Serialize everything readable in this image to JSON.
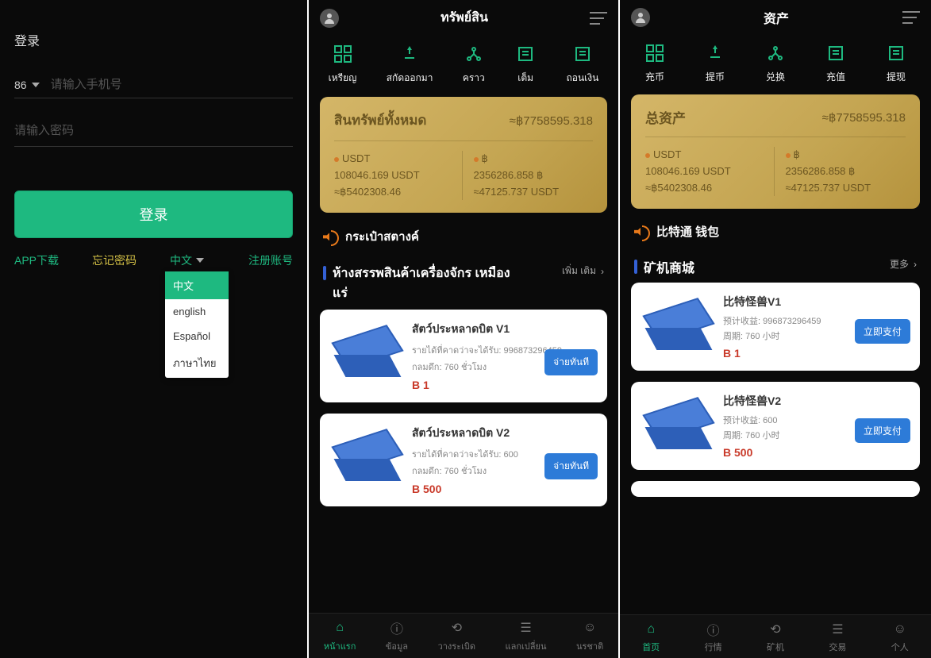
{
  "panel1": {
    "title": "登录",
    "country_code": "86",
    "phone_placeholder": "请输入手机号",
    "password_placeholder": "请输入密码",
    "login_btn": "登录",
    "app_download": "APP下载",
    "forgot_pwd": "忘记密码",
    "lang_current": "中文",
    "register": "注册账号",
    "lang_options": [
      "中文",
      "english",
      "Español",
      "ภาษาไทย"
    ]
  },
  "panel2": {
    "title": "ทรัพย์สิน",
    "actions": [
      {
        "label": "เหรียญ"
      },
      {
        "label": "สกัดออกมา"
      },
      {
        "label": "คราว"
      },
      {
        "label": "เต็ม"
      },
      {
        "label": "ถอนเงิน"
      }
    ],
    "asset": {
      "title": "สินทรัพย์ทั้งหมด",
      "total": "≈฿7758595.318",
      "col1_l1": "USDT",
      "col1_l2": "108046.169 USDT",
      "col1_l3": "≈฿5402308.46",
      "col2_l1": "฿",
      "col2_l2": "2356286.858 ฿",
      "col2_l3": "≈47125.737 USDT"
    },
    "announce": "กระเป๋าสตางค์",
    "section_title": "ห้างสรรพสินค้าเครื่องจักร เหมืองแร่",
    "more": "เพิ่ม เติม",
    "cards": [
      {
        "title": "สัตว์ประหลาดบิต V1",
        "line1": "รายได้ที่คาดว่าจะได้รับ: 996873296459",
        "line2": "กลมดึก: 760 ชั่วโมง",
        "price": "B 1",
        "pay": "จ่ายทันที"
      },
      {
        "title": "สัตว์ประหลาดบิต V2",
        "line1": "รายได้ที่คาดว่าจะได้รับ: 600",
        "line2": "กลมดึก: 760 ชั่วโมง",
        "price": "B 500",
        "pay": "จ่ายทันที"
      }
    ],
    "nav": [
      {
        "label": "หน้าแรก"
      },
      {
        "label": "ข้อมูล"
      },
      {
        "label": "วางระเบิด"
      },
      {
        "label": "แลกเปลี่ยน"
      },
      {
        "label": "นรชาติ"
      }
    ]
  },
  "panel3": {
    "title": "资产",
    "actions": [
      {
        "label": "充币"
      },
      {
        "label": "提币"
      },
      {
        "label": "兑换"
      },
      {
        "label": "充值"
      },
      {
        "label": "提现"
      }
    ],
    "asset": {
      "title": "总资产",
      "total": "≈฿7758595.318",
      "col1_l1": "USDT",
      "col1_l2": "108046.169 USDT",
      "col1_l3": "≈฿5402308.46",
      "col2_l1": "฿",
      "col2_l2": "2356286.858 ฿",
      "col2_l3": "≈47125.737 USDT"
    },
    "announce": "比特通 钱包",
    "section_title": "矿机商城",
    "more": "更多",
    "cards": [
      {
        "title": "比特怪兽V1",
        "line1": "预计收益: 996873296459",
        "line2": "周期: 760 小时",
        "price": "B 1",
        "pay": "立即支付"
      },
      {
        "title": "比特怪兽V2",
        "line1": "预计收益: 600",
        "line2": "周期: 760 小时",
        "price": "B 500",
        "pay": "立即支付"
      }
    ],
    "nav": [
      {
        "label": "首页"
      },
      {
        "label": "行情"
      },
      {
        "label": "矿机"
      },
      {
        "label": "交易"
      },
      {
        "label": "个人"
      }
    ]
  }
}
